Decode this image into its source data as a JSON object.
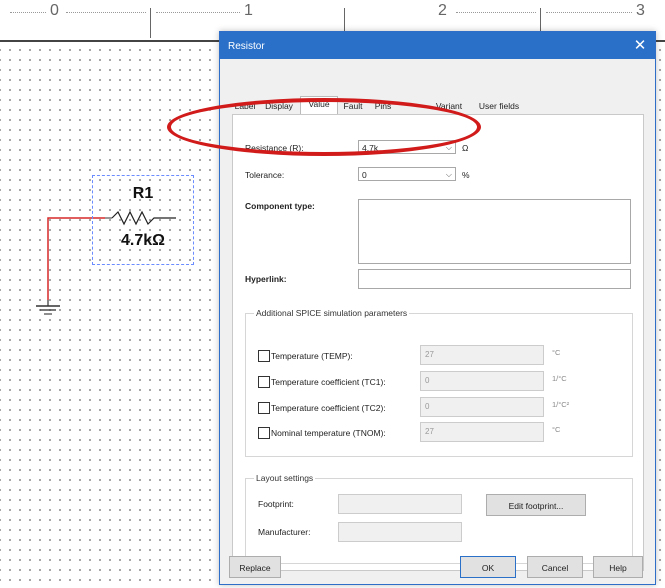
{
  "ruler": {
    "ticks": [
      "0",
      "1",
      "2",
      "3"
    ]
  },
  "schematic": {
    "refdes": "R1",
    "value": "4.7kΩ"
  },
  "dialog": {
    "title": "Resistor",
    "close_glyph": "✕",
    "tabs": [
      "Label",
      "Display",
      "Value",
      "Fault",
      "Pins",
      "Variant",
      "User fields"
    ],
    "active_tab": "Value",
    "resistance": {
      "label": "Resistance (R):",
      "value": "4.7k",
      "unit": "Ω"
    },
    "tolerance": {
      "label": "Tolerance:",
      "value": "0",
      "unit": "%"
    },
    "component_type": {
      "label": "Component type:",
      "value": ""
    },
    "hyperlink": {
      "label": "Hyperlink:",
      "value": ""
    },
    "spice": {
      "title": "Additional SPICE simulation parameters",
      "params": [
        {
          "label": "Temperature (TEMP):",
          "value": "27",
          "unit": "°C",
          "checked": false
        },
        {
          "label": "Temperature coefficient (TC1):",
          "value": "0",
          "unit": "1/°C",
          "checked": false
        },
        {
          "label": "Temperature coefficient (TC2):",
          "value": "0",
          "unit": "1/°C²",
          "checked": false
        },
        {
          "label": "Nominal temperature (TNOM):",
          "value": "27",
          "unit": "°C",
          "checked": false
        }
      ]
    },
    "layout": {
      "title": "Layout settings",
      "footprint_label": "Footprint:",
      "footprint_value": "",
      "manufacturer_label": "Manufacturer:",
      "manufacturer_value": "",
      "edit_footprint": "Edit footprint..."
    },
    "buttons": {
      "replace": "Replace",
      "ok": "OK",
      "cancel": "Cancel",
      "help": "Help"
    }
  },
  "colors": {
    "titlebar": "#2a70c9",
    "wire": "#d62828",
    "annotation": "#d11a1a",
    "selection": "#6a8cff"
  },
  "annotation": {
    "shape": "ellipse",
    "target": "resistance-field"
  }
}
